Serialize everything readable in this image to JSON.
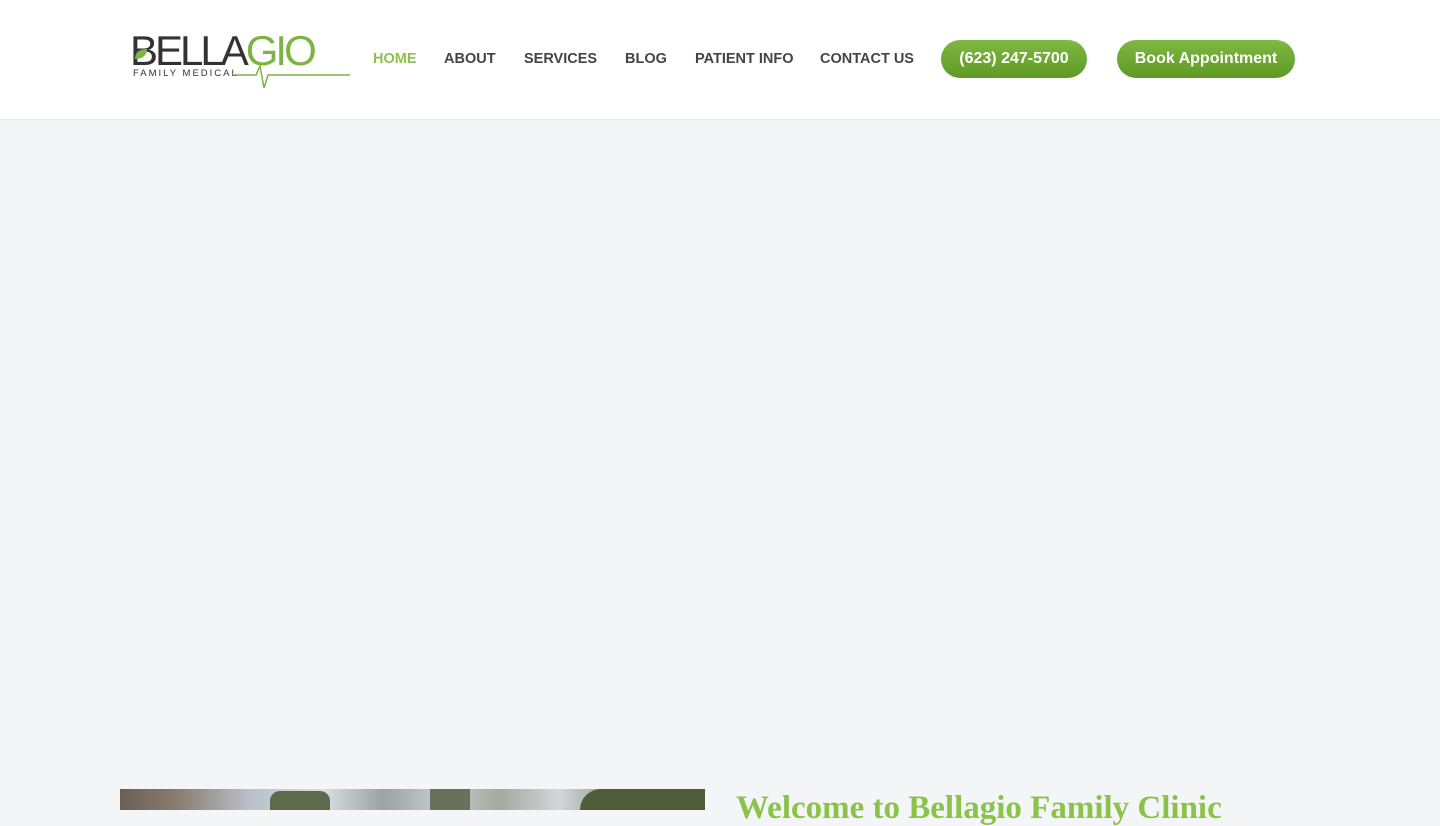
{
  "logo": {
    "word_dark": "BELLA",
    "word_green": "GIO",
    "subtitle": "FAMILY MEDICAL",
    "leaf_icon": "leaf-icon",
    "pulse_icon": "heartbeat-line-icon"
  },
  "nav": {
    "items": [
      {
        "label": "HOME",
        "active": true
      },
      {
        "label": "ABOUT",
        "active": false
      },
      {
        "label": "SERVICES",
        "active": false
      },
      {
        "label": "BLOG",
        "active": false
      },
      {
        "label": "PATIENT INFO",
        "active": false
      },
      {
        "label": "CONTACT US",
        "active": false
      }
    ]
  },
  "buttons": {
    "phone": "(623) 247-5700",
    "book": "Book Appointment"
  },
  "welcome": {
    "heading": "Welcome to Bellagio Family Clinic"
  },
  "colors": {
    "brand_green": "#8bc34a",
    "button_green": "#6fa832",
    "nav_text": "#444444",
    "background": "#f3f5f7"
  }
}
